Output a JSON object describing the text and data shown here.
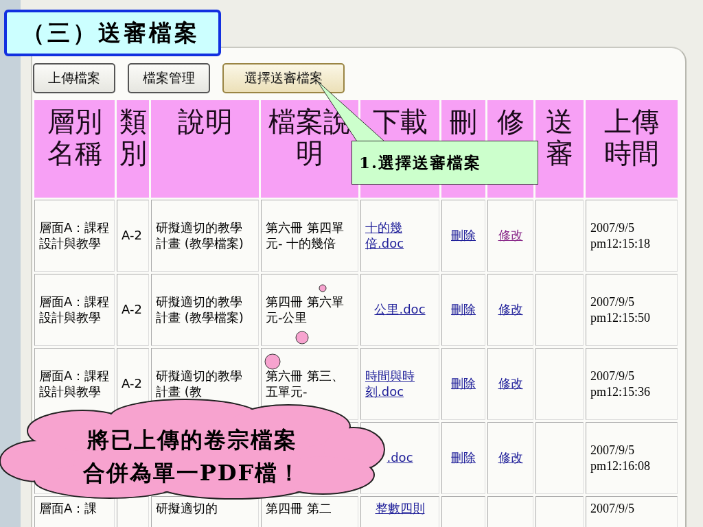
{
  "slide_title": "（三）送審檔案",
  "tabs": [
    {
      "label": "上傳檔案",
      "selected": false
    },
    {
      "label": "檔案管理",
      "selected": false
    },
    {
      "label": "選擇送審檔案",
      "selected": true
    }
  ],
  "table": {
    "columns": [
      "層別名稱",
      "類別",
      "說明",
      "檔案說明",
      "下載",
      "刪",
      "修",
      "送審",
      "上傳時間"
    ],
    "rows": [
      {
        "layer": "層面A：課程設計與教學",
        "category": "A-2",
        "description": "研擬適切的教學計畫 (教學檔案)",
        "file_description": "第六冊 第四單元- 十的幾倍",
        "download": "十的幾倍.doc",
        "delete": "刪除",
        "edit": "修改",
        "edit_visited": true,
        "upload_time": "2007/9/5 pm12:15:18"
      },
      {
        "layer": "層面A：課程設計與教學",
        "category": "A-2",
        "description": "研擬適切的教學計畫 (教學檔案)",
        "file_description": "第四冊 第六單元-公里",
        "download": "公里.doc",
        "delete": "刪除",
        "edit": "修改",
        "edit_visited": false,
        "upload_time": "2007/9/5 pm12:15:50"
      },
      {
        "layer": "層面A：課程設計與教學",
        "category": "A-2",
        "description": "研擬適切的教學計畫 (教",
        "file_description": "第六冊 第三、五單元-",
        "download": "時間與時刻.doc",
        "delete": "刪除",
        "edit": "修改",
        "edit_visited": false,
        "upload_time": "2007/9/5 pm12:15:36"
      },
      {
        "download": ".doc",
        "delete": "刪除",
        "edit": "修改",
        "edit_visited": false,
        "upload_time": "2007/9/5 pm12:16:08"
      },
      {
        "layer": "層面A：課",
        "description": "研擬適切的",
        "file_description": "第四冊 第二",
        "download": "整數四則",
        "upload_time": "2007/9/5"
      }
    ]
  },
  "callout": "1.選擇送審檔案",
  "cloud_note": [
    "將已上傳的卷宗檔案",
    "合併為單一PDF檔！"
  ]
}
